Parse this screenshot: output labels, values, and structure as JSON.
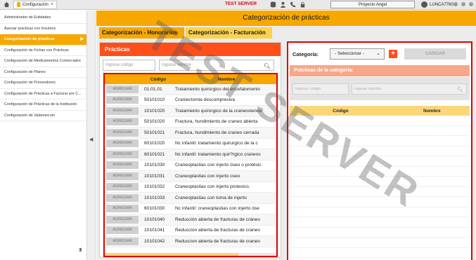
{
  "topbar": {
    "tab_label": "Configuración",
    "test_server": "TEST SERVER",
    "project": "Proyecto Angel",
    "user": "LUNCA7760"
  },
  "sidebar": {
    "items": [
      {
        "label": "Administrador de Entidades"
      },
      {
        "label": "Asociar practicas con Insumos"
      },
      {
        "label": "Categorización de prácticas",
        "active": true
      },
      {
        "label": "Configuración de Fichas con Prácticas"
      },
      {
        "label": "Configuración de Medicamentos Comerciales"
      },
      {
        "label": "Configuración de Planes"
      },
      {
        "label": "Configuración de Proveedores"
      },
      {
        "label": "Configuración de Prácticas a Facturar por C..."
      },
      {
        "label": "Configuración de Prácticas de la Institución"
      },
      {
        "label": "Configuración de Vademecum"
      }
    ]
  },
  "main": {
    "title": "Categorización de prácticas",
    "tabs": [
      {
        "label": "Categorización - Honorarios"
      },
      {
        "label": "Categorización - Facturación"
      }
    ]
  },
  "left_panel": {
    "title": "Prácticas",
    "code_placeholder": "Ingrese código",
    "name_placeholder": "Ingrese nombre",
    "columns": [
      "",
      "Código",
      "Nombre"
    ],
    "add_label": "AGREGAR",
    "rows": [
      {
        "code": "01.01.01",
        "name": "Tratamiento quirúrgico del encefalomenin"
      },
      {
        "code": "50101010",
        "name": "Craniectomia descompresiva"
      },
      {
        "code": "10101020",
        "name": "Tratamiento quirúrgico de la craneostenos"
      },
      {
        "code": "50101020",
        "name": "Fractura, hundimiento de craneo abierta"
      },
      {
        "code": "50101021",
        "name": "Fractura, hundimiento de craneo cerrada"
      },
      {
        "code": "60101020",
        "name": "Nc infantil: tratamiento quirurgico de la c"
      },
      {
        "code": "60101021",
        "name": "Nc infantil: tratamiento quir?rgico craneos"
      },
      {
        "code": "10101030",
        "name": "Craneoplastias con injerto óseo o protésic"
      },
      {
        "code": "10101031",
        "name": "Craneoplastias con injerto oseo"
      },
      {
        "code": "10101032",
        "name": "Craneoplastias con injerto protesico."
      },
      {
        "code": "10101033",
        "name": "Craneoplastias con toma de  injerto"
      },
      {
        "code": "60101030",
        "name": "Nc infantil: craneoplastias con injerto óse"
      },
      {
        "code": "10101040",
        "name": "Reducción abierta de fracturas de cráneo"
      },
      {
        "code": "10101041",
        "name": "Reduccion abierta de fracturas de craneo"
      },
      {
        "code": "10101042",
        "name": "Reduccion abierta de fracturas de craneo"
      }
    ]
  },
  "right_panel": {
    "category_label": "Categoría:",
    "select_value": "- Seleccionar -",
    "load_label": "CARGAR",
    "subtitle": "Prácticas de la categoría:",
    "code_placeholder": "Ingrese código",
    "name_placeholder": "Ingrese nombre",
    "columns": [
      "Código",
      "Nombre"
    ]
  },
  "watermark": "TEST SERVER",
  "colors": {
    "accent": "#f7a800",
    "panel_header": "#ff4e1a",
    "highlight_border": "#e00000"
  }
}
